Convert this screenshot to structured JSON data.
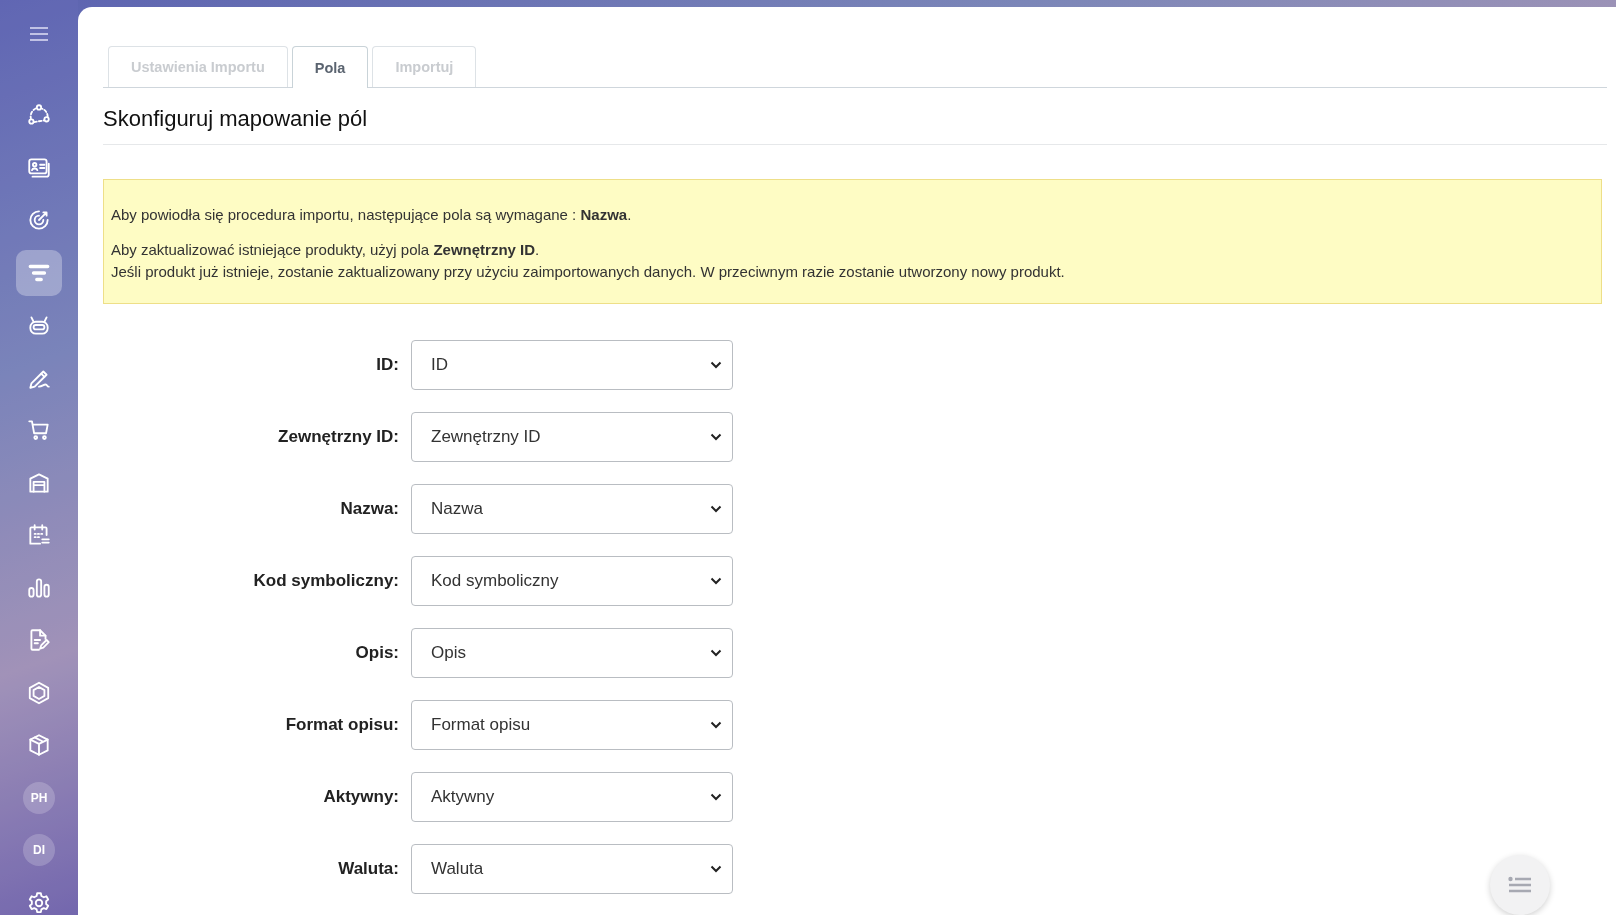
{
  "sidebar": {
    "items": [
      {
        "kind": "icon",
        "selected": false
      },
      {
        "kind": "icon",
        "selected": false
      },
      {
        "kind": "icon",
        "selected": false
      },
      {
        "kind": "icon",
        "selected": true
      },
      {
        "kind": "icon",
        "selected": false
      },
      {
        "kind": "icon",
        "selected": false
      },
      {
        "kind": "icon",
        "selected": false
      },
      {
        "kind": "icon",
        "selected": false
      },
      {
        "kind": "icon",
        "selected": false
      },
      {
        "kind": "icon",
        "selected": false
      },
      {
        "kind": "icon",
        "selected": false
      },
      {
        "kind": "icon",
        "selected": false
      },
      {
        "kind": "icon",
        "selected": false
      },
      {
        "kind": "avatar",
        "text": "PH",
        "selected": false
      },
      {
        "kind": "avatar",
        "text": "DI",
        "selected": false
      },
      {
        "kind": "icon",
        "selected": false
      }
    ]
  },
  "tabs": [
    {
      "label": "Ustawienia Importu",
      "selected": false
    },
    {
      "label": "Pola",
      "selected": true
    },
    {
      "label": "Importuj",
      "selected": false
    }
  ],
  "title": "Skonfiguruj mapowanie pól",
  "notice": {
    "paragraphs": [
      [
        "Aby powiodła się procedura importu, następujące pola są wymagane : **Nazwa**."
      ],
      [
        "Aby zaktualizować istniejące produkty, użyj pola **Zewnętrzny ID**.",
        "Jeśli produkt już istnieje, zostanie zaktualizowany przy użyciu zaimportowanych danych. W przeciwnym razie zostanie utworzony nowy produkt."
      ]
    ]
  },
  "fields": [
    {
      "label": "ID:",
      "value": "ID"
    },
    {
      "label": "Zewnętrzny ID:",
      "value": "Zewnętrzny ID"
    },
    {
      "label": "Nazwa:",
      "value": "Nazwa"
    },
    {
      "label": "Kod symboliczny:",
      "value": "Kod symboliczny"
    },
    {
      "label": "Opis:",
      "value": "Opis"
    },
    {
      "label": "Format opisu:",
      "value": "Format opisu"
    },
    {
      "label": "Aktywny:",
      "value": "Aktywny"
    },
    {
      "label": "Waluta:",
      "value": "Waluta"
    }
  ]
}
